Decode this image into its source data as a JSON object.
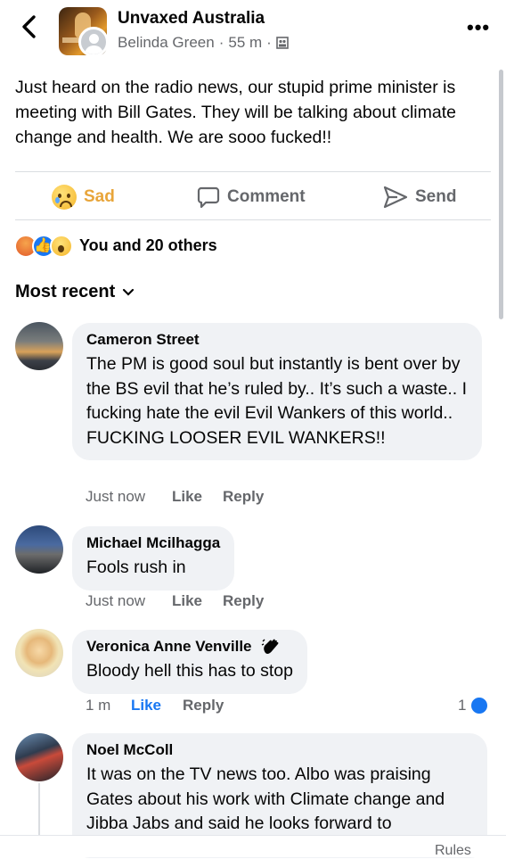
{
  "header": {
    "group_name": "Unvaxed Australia",
    "author": "Belinda Green",
    "time": "55 m",
    "separator": "·",
    "more_label": "•••",
    "icons": {
      "back": "chevron-left-icon",
      "privacy": "group-icon",
      "more": "more-icon"
    }
  },
  "post": {
    "text": "Just heard on the radio news, our stupid prime minister is meeting with Bill Gates. They will be talking about climate change and health. We are sooo fucked!!"
  },
  "actions": {
    "sad": "Sad",
    "comment": "Comment",
    "send": "Send"
  },
  "reactions": {
    "types": [
      "angry",
      "like",
      "wow"
    ],
    "summary": "You and 20 others"
  },
  "sort_label": "Most recent",
  "comments": [
    {
      "name": "Cameron Street",
      "text": "The PM is good soul but instantly is bent over by the BS evil that he’s ruled by.. It’s such a waste.. I fucking hate the evil Evil Wankers of this world.. FUCKING LOOSER EVIL WANKERS!!",
      "time": "Just now",
      "like": "Like",
      "reply": "Reply"
    },
    {
      "name": "Michael Mcilhagga",
      "text": "Fools rush in",
      "time": "Just now",
      "like": "Like",
      "reply": "Reply"
    },
    {
      "name": "Veronica Anne Venville",
      "badge_icon": "waving-hand-icon",
      "text": "Bloody hell this has to stop",
      "time": "1 m",
      "like": "Like",
      "liked": true,
      "reply": "Reply",
      "reaction_count": "1"
    },
    {
      "name": "Noel McColl",
      "text": "It was on the TV news too. Albo was praising Gates about his work with Climate change and Jibba Jabs and said he looks forward to"
    }
  ],
  "footer": {
    "rules": "Rules"
  },
  "colors": {
    "accent": "#1877f2",
    "sad": "#e8a53a",
    "bubble": "#f0f2f5",
    "muted": "#65676b"
  }
}
